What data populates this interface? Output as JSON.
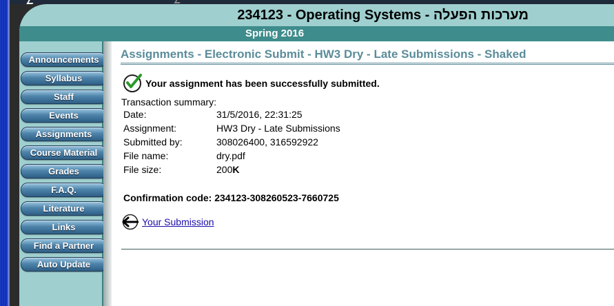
{
  "header": {
    "course_title": "234123 - Operating Systems - מערכות הפעלה",
    "semester": "Spring 2016"
  },
  "sidebar": {
    "items": [
      {
        "label": "Announcements"
      },
      {
        "label": "Syllabus"
      },
      {
        "label": "Staff"
      },
      {
        "label": "Events"
      },
      {
        "label": "Assignments"
      },
      {
        "label": "Course Material"
      },
      {
        "label": "Grades"
      },
      {
        "label": "F.A.Q."
      },
      {
        "label": "Literature"
      },
      {
        "label": "Links"
      },
      {
        "label": "Find a Partner"
      },
      {
        "label": "Auto Update"
      }
    ]
  },
  "main": {
    "heading": "Assignments - Electronic Submit - HW3 Dry - Late Submissions - Shaked",
    "success_message": "Your assignment has been successfully submitted.",
    "summary_label": "Transaction summary:",
    "summary": {
      "date_label": "Date:",
      "date_value": "31/5/2016, 22:31:25",
      "assignment_label": "Assignment:",
      "assignment_value": "HW3 Dry - Late Submissions",
      "submitted_by_label": "Submitted by:",
      "submitted_by_value": "308026400, 316592922",
      "file_name_label": "File name:",
      "file_name_value": "dry.pdf",
      "file_size_label": "File size:",
      "file_size_number": "200",
      "file_size_unit": "K"
    },
    "confirmation_label": "Confirmation code:",
    "confirmation_code": "234123-308260523-7660725",
    "your_submission_link": "Your Submission"
  },
  "icons": {
    "success": "check-circle-icon",
    "back": "back-arrow-icon"
  },
  "colors": {
    "header_bg": "#9fcfcf",
    "semester_bar": "#3f8c8c",
    "heading_text": "#5a8c99",
    "nav_button": "#4f84aa",
    "link": "#1a0dab",
    "check_green": "#2a9a2a"
  }
}
